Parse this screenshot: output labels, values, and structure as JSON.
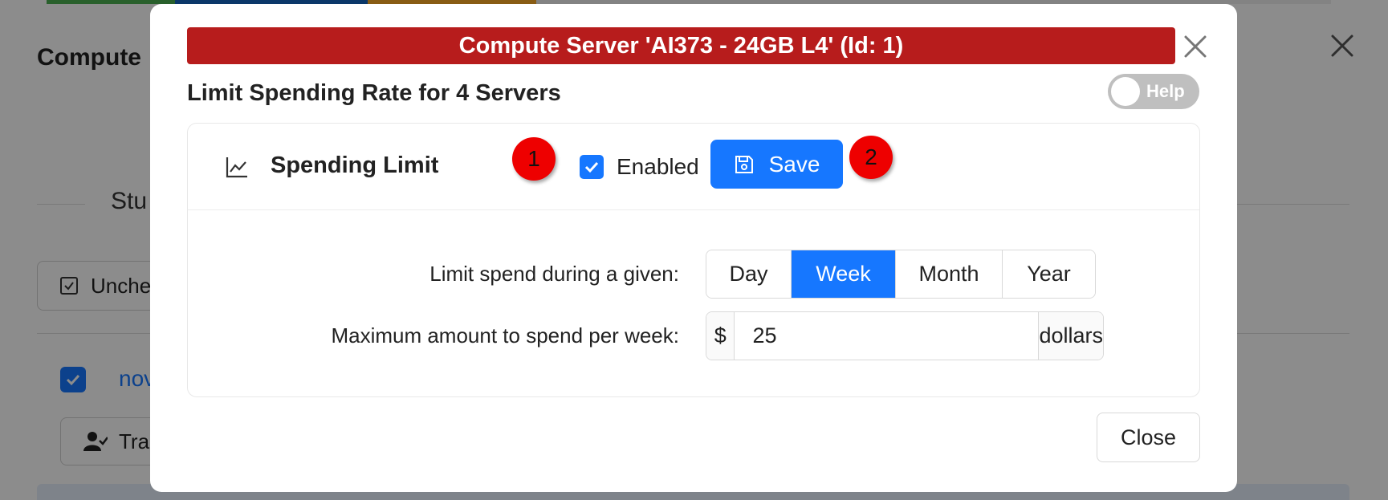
{
  "background": {
    "title": "Compute",
    "tab_label": "Stu",
    "uncheck_label": "Unche",
    "link_text": "nov",
    "transfer_label": "Tra"
  },
  "modal": {
    "banner": "Compute Server 'AI373 - 24GB L4' (Id: 1)",
    "title": "Limit Spending Rate for 4 Servers",
    "help_label": "Help",
    "help_on": false,
    "section_title": "Spending Limit",
    "enabled_label": "Enabled",
    "enabled_checked": true,
    "save_label": "Save",
    "markers": [
      "1",
      "2"
    ],
    "period_label": "Limit spend during a given:",
    "periods": [
      "Day",
      "Week",
      "Month",
      "Year"
    ],
    "selected_period": "Week",
    "amount_label": "Maximum amount to spend per week:",
    "amount_prefix": "$",
    "amount_value": "25",
    "amount_suffix": "dollars",
    "close_label": "Close"
  },
  "colors": {
    "banner_bg": "#b71c1c",
    "accent": "#1677ff",
    "marker": "#ee0000"
  }
}
